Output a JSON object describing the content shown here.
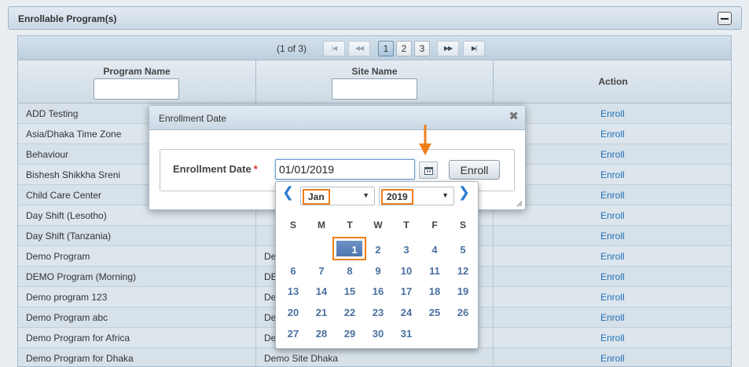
{
  "panel": {
    "title": "Enrollable Program(s)"
  },
  "pager": {
    "info": "(1 of 3)",
    "pages": [
      "1",
      "2",
      "3"
    ],
    "current": "1"
  },
  "columns": {
    "program": "Program Name",
    "site": "Site Name",
    "action": "Action"
  },
  "rows": [
    {
      "program": "ADD Testing",
      "site": "",
      "action": "Enroll"
    },
    {
      "program": "Asia/Dhaka Time Zone",
      "site": "",
      "action": "Enroll"
    },
    {
      "program": "Behaviour",
      "site": "",
      "action": "Enroll"
    },
    {
      "program": "Bishesh Shikkha Sreni",
      "site": "",
      "action": "Enroll"
    },
    {
      "program": "Child Care Center",
      "site": "",
      "action": "Enroll"
    },
    {
      "program": "Day Shift (Lesotho)",
      "site": "",
      "action": "Enroll"
    },
    {
      "program": "Day Shift (Tanzania)",
      "site": "",
      "action": "Enroll"
    },
    {
      "program": "Demo Program",
      "site": "De",
      "action": "Enroll"
    },
    {
      "program": "DEMO Program (Morning)",
      "site": "DE",
      "action": "Enroll"
    },
    {
      "program": "Demo program 123",
      "site": "De",
      "action": "Enroll"
    },
    {
      "program": "Demo Program abc",
      "site": "De",
      "action": "Enroll"
    },
    {
      "program": "Demo Program for Africa",
      "site": "De",
      "action": "Enroll"
    },
    {
      "program": "Demo Program for Dhaka",
      "site": "Demo Site Dhaka",
      "action": "Enroll"
    }
  ],
  "modal": {
    "title": "Enrollment Date",
    "field_label": "Enrollment Date",
    "required_mark": "*",
    "date_value": "01/01/2019",
    "enroll_label": "Enroll"
  },
  "datepicker": {
    "prev": "❮",
    "next": "❯",
    "month": "Jan",
    "year": "2019",
    "weekdays": [
      "S",
      "M",
      "T",
      "W",
      "T",
      "F",
      "S"
    ],
    "weeks": [
      [
        "",
        "",
        "1",
        "2",
        "3",
        "4",
        "5"
      ],
      [
        "6",
        "7",
        "8",
        "9",
        "10",
        "11",
        "12"
      ],
      [
        "13",
        "14",
        "15",
        "16",
        "17",
        "18",
        "19"
      ],
      [
        "20",
        "21",
        "22",
        "23",
        "24",
        "25",
        "26"
      ],
      [
        "27",
        "28",
        "29",
        "30",
        "31",
        "",
        ""
      ]
    ],
    "selected_day": "1"
  },
  "colors": {
    "link": "#1f6fb6",
    "highlight": "#ef7f1a",
    "selected_day_bg": "#5a80b8"
  }
}
